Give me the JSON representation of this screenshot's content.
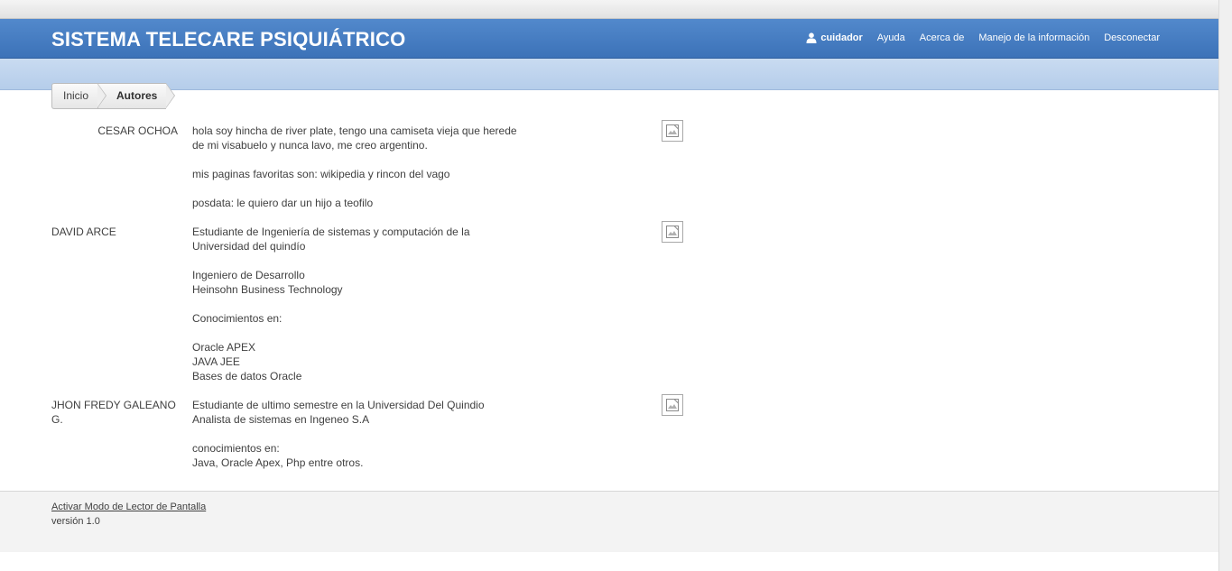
{
  "header": {
    "title": "SISTEMA TELECARE PSIQUIÁTRICO",
    "user": "cuidador",
    "nav": [
      "Ayuda",
      "Acerca de",
      "Manejo de la información",
      "Desconectar"
    ]
  },
  "breadcrumb": [
    "Inicio",
    "Autores"
  ],
  "authors": [
    {
      "name": "CESAR OCHOA",
      "bio": [
        "hola soy hincha de river plate, tengo una camiseta vieja que herede de mi visabuelo y nunca lavo, me creo argentino.",
        "mis paginas favoritas son: wikipedia y rincon del vago",
        "posdata: le quiero dar un hijo a teofilo"
      ],
      "photo_icon": "broken-image-icon"
    },
    {
      "name": "DAVID ARCE",
      "bio": [
        "Estudiante de Ingeniería de sistemas y computación de la Universidad del quindío",
        "Ingeniero de Desarrollo\nHeinsohn Business Technology",
        "Conocimientos en:",
        "Oracle APEX\nJAVA JEE\nBases de datos Oracle"
      ],
      "photo_icon": "broken-image-icon"
    },
    {
      "name": "JHON FREDY GALEANO G.",
      "bio": [
        "Estudiante de ultimo semestre en la Universidad Del Quindio\nAnalista de sistemas en Ingeneo S.A",
        "conocimientos en:\nJava, Oracle Apex, Php entre otros."
      ],
      "photo_icon": "broken-image-icon"
    }
  ],
  "footer": {
    "screen_reader_link": "Activar Modo de Lector de Pantalla",
    "version": "versión 1.0"
  },
  "colors": {
    "header_blue": "#3c72b8",
    "subbar_blue": "#c9dbf1"
  }
}
